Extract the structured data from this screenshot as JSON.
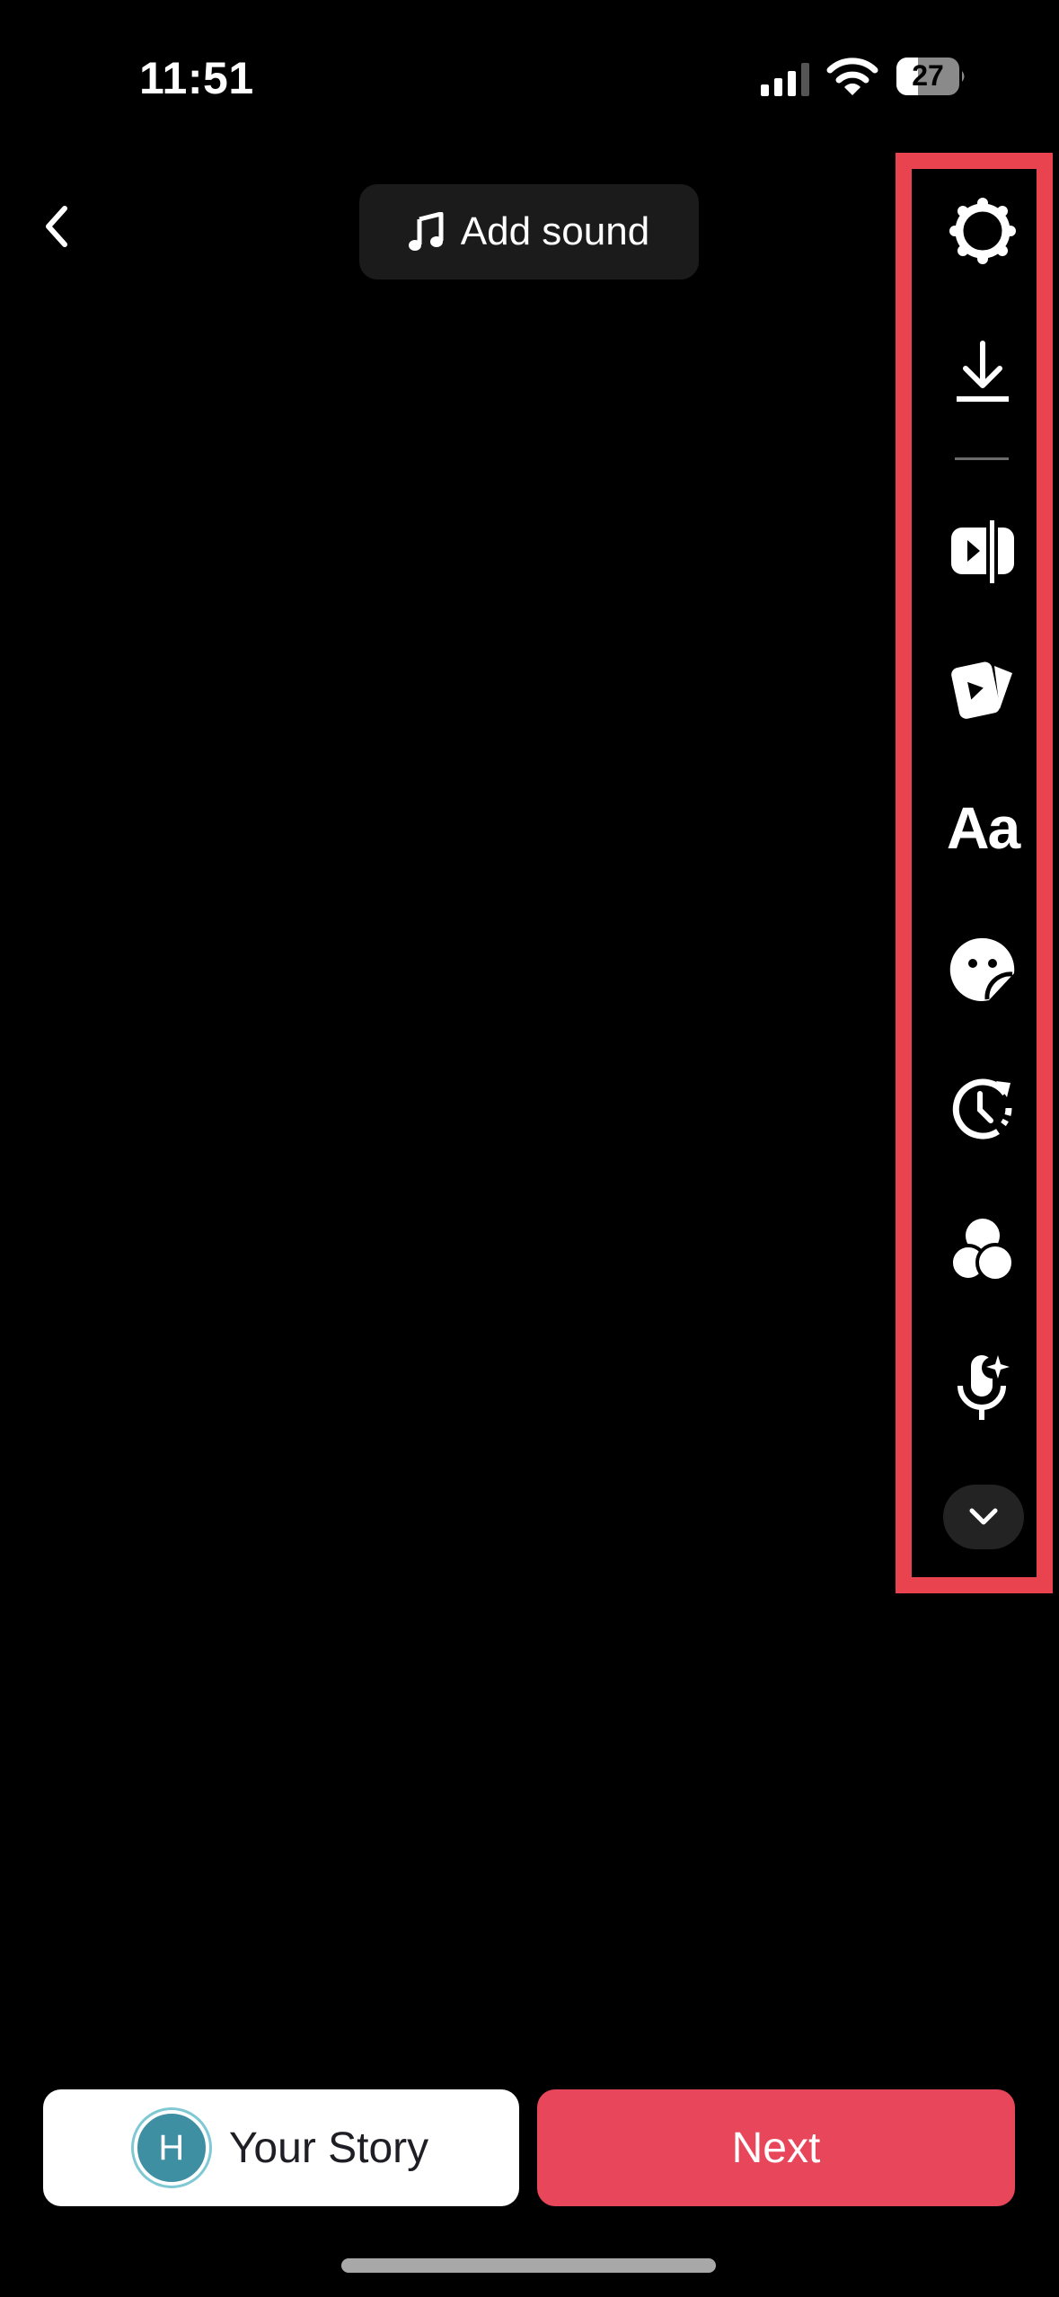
{
  "status_bar": {
    "time": "11:51",
    "signal_bars_filled": 3,
    "signal_bars_total": 4,
    "wifi_icon": "wifi-icon",
    "battery_percent": "27"
  },
  "header": {
    "back_icon": "chevron-left-icon",
    "add_sound": {
      "icon": "music-note-icon",
      "label": "Add sound"
    }
  },
  "toolbar": {
    "highlight_color": "#e8434f",
    "tools": [
      {
        "name": "settings",
        "icon": "gear-icon"
      },
      {
        "name": "download",
        "icon": "download-icon"
      },
      {
        "name": "clip",
        "icon": "video-clip-icon"
      },
      {
        "name": "templates",
        "icon": "video-cards-icon"
      },
      {
        "name": "text",
        "icon": "text-icon",
        "glyph": "Aa"
      },
      {
        "name": "stickers",
        "icon": "sticker-icon"
      },
      {
        "name": "speed",
        "icon": "clock-refresh-icon"
      },
      {
        "name": "filters",
        "icon": "filters-icon"
      },
      {
        "name": "voice-effects",
        "icon": "microphone-sparkle-icon"
      }
    ],
    "more_icon": "chevron-down-icon"
  },
  "footer": {
    "story_button": {
      "avatar_initial": "H",
      "avatar_color": "#3f8fa3",
      "label": "Your Story"
    },
    "next_button": {
      "label": "Next",
      "color": "#e8465a"
    }
  }
}
